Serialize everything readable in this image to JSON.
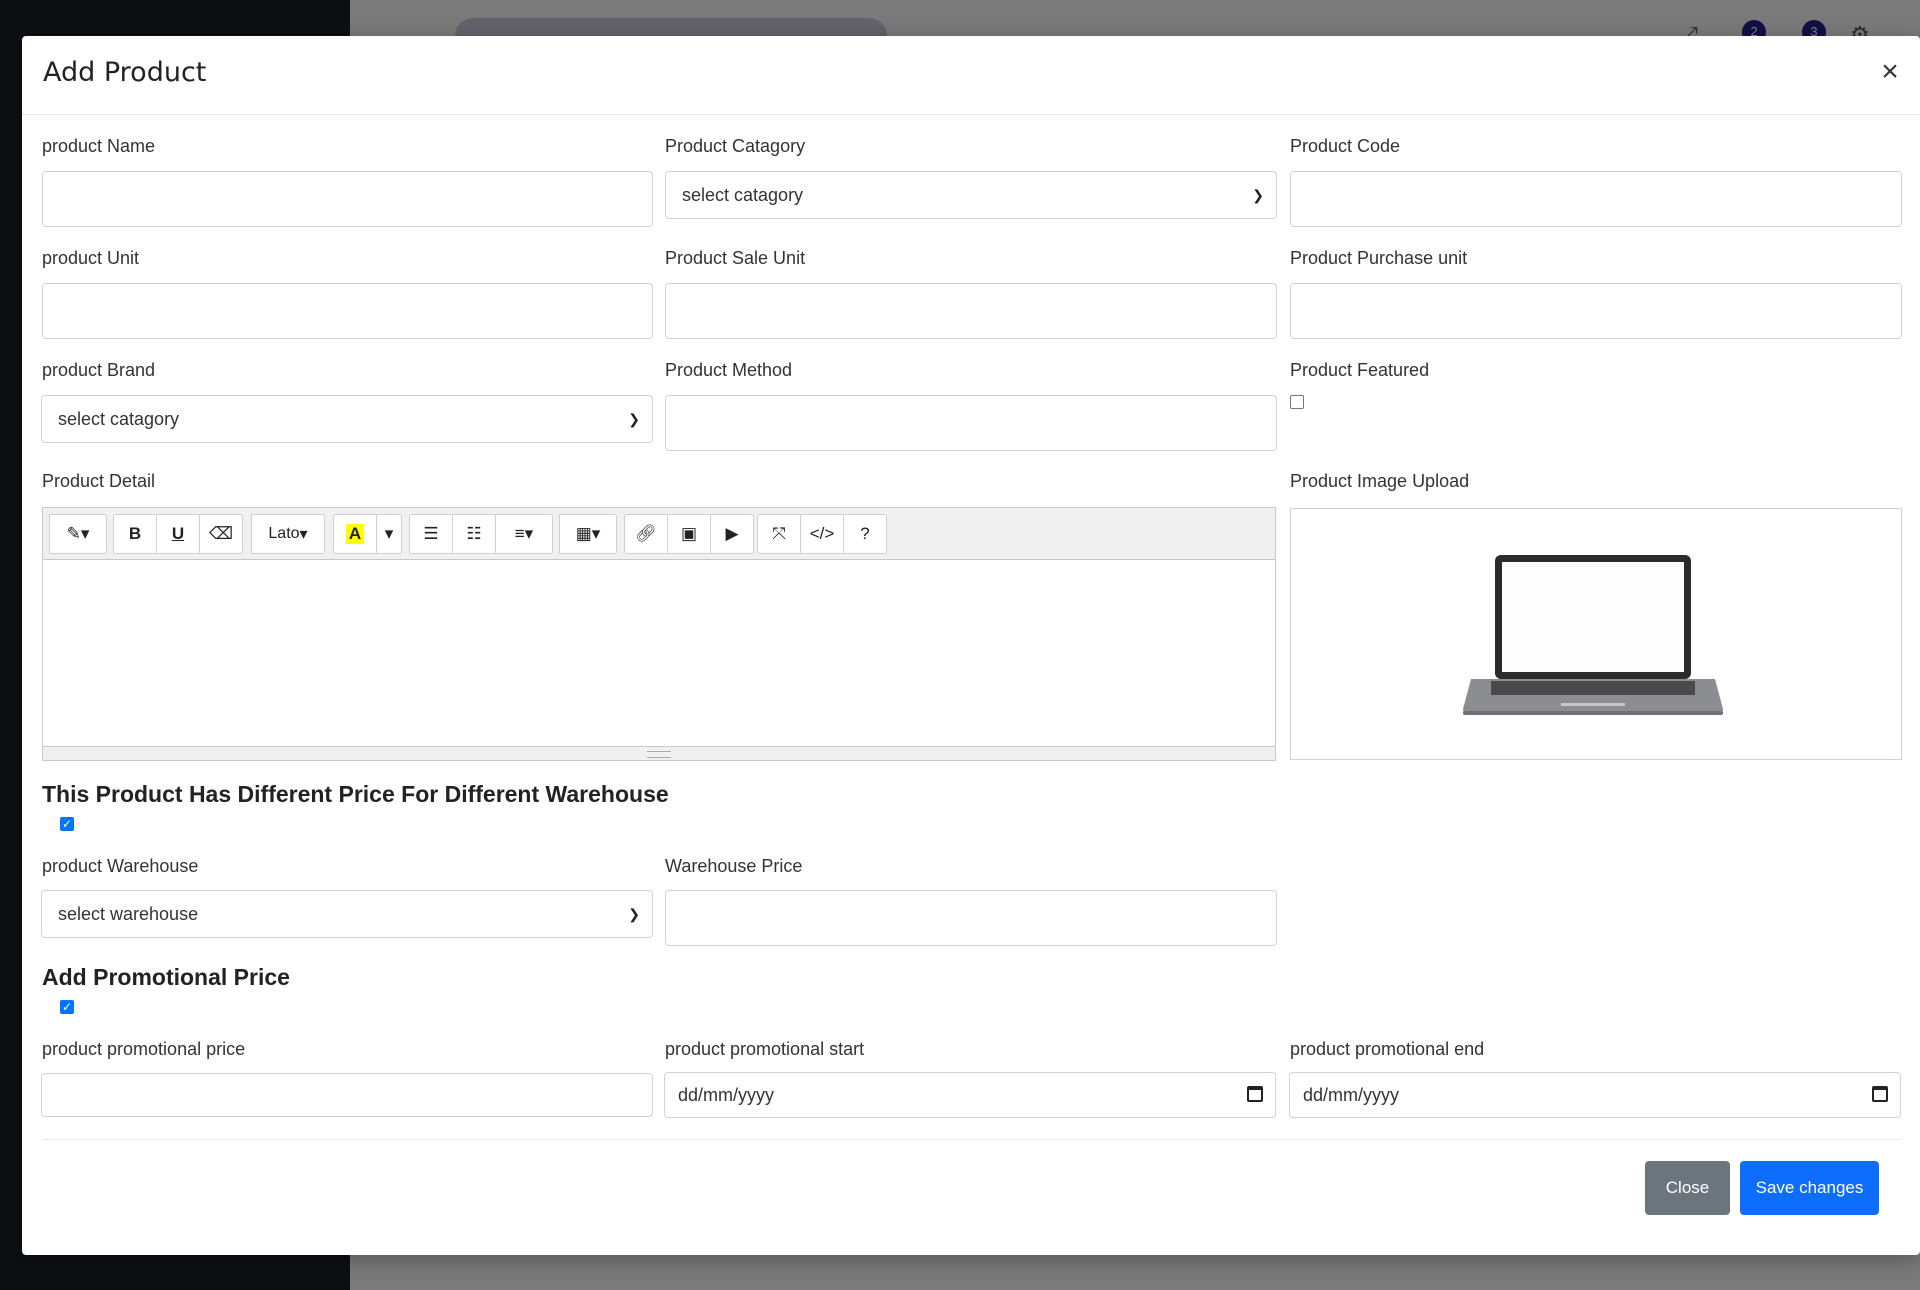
{
  "background": {
    "badges": [
      "2",
      "3"
    ]
  },
  "modal": {
    "title": "Add Product",
    "close_glyph": "×"
  },
  "fields": {
    "product_name": {
      "label": "product Name",
      "value": ""
    },
    "product_category": {
      "label": "Product Catagory",
      "selected": "select catagory"
    },
    "product_code": {
      "label": "Product Code",
      "value": ""
    },
    "product_unit": {
      "label": "product Unit",
      "value": ""
    },
    "product_sale_unit": {
      "label": "Product Sale Unit",
      "value": ""
    },
    "product_purchase_unit": {
      "label": "Product Purchase unit",
      "value": ""
    },
    "product_brand": {
      "label": "product Brand",
      "selected": "select catagory"
    },
    "product_method": {
      "label": "Product Method",
      "value": ""
    },
    "product_featured": {
      "label": "Product Featured",
      "checked": false
    },
    "product_detail": {
      "label": "Product Detail"
    },
    "product_image_upload": {
      "label": "Product Image Upload"
    },
    "product_warehouse": {
      "label": "product Warehouse",
      "selected": "select warehouse"
    },
    "warehouse_price": {
      "label": "Warehouse Price",
      "value": ""
    },
    "promotional_price": {
      "label": "product promotional price",
      "value": ""
    },
    "promotional_start": {
      "label": "product promotional start",
      "value": "dd/mm/yyyy"
    },
    "promotional_end": {
      "label": "product promotional end",
      "value": "dd/mm/yyyy"
    }
  },
  "sections": {
    "different_price": {
      "title": "This Product Has Different Price For Different Warehouse",
      "checked": true
    },
    "promotional": {
      "title": "Add Promotional Price",
      "checked": true
    }
  },
  "editor": {
    "font_name": "Lato",
    "help_label": "?",
    "code_label": "</>"
  },
  "footer": {
    "close_label": "Close",
    "save_label": "Save changes"
  },
  "colors": {
    "primary": "#0d6efd",
    "secondary": "#6c757d",
    "checkbox": "#0075ff",
    "highlight": "#ffff00"
  }
}
